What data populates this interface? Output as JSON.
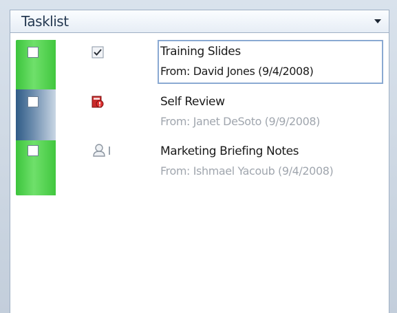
{
  "panel": {
    "title": "Tasklist"
  },
  "tasks": [
    {
      "title": "Training Slides",
      "subtitle": "From: David Jones (9/4/2008)",
      "icon": "checkmark-icon",
      "checked": false,
      "selected": true
    },
    {
      "title": "Self Review",
      "subtitle": "From: Janet DeSoto (9/9/2008)",
      "icon": "red-document-icon",
      "checked": false,
      "selected": false
    },
    {
      "title": "Marketing Briefing Notes",
      "subtitle": "From: Ishmael Yacoub (9/4/2008)",
      "icon": "person-icon",
      "checked": false,
      "selected": false
    }
  ],
  "colors": {
    "status_green": "#3cc43c",
    "status_blue": "#2f5b86",
    "selection_border": "#8aa9d2",
    "subtitle_gray": "#a0a6ae"
  }
}
